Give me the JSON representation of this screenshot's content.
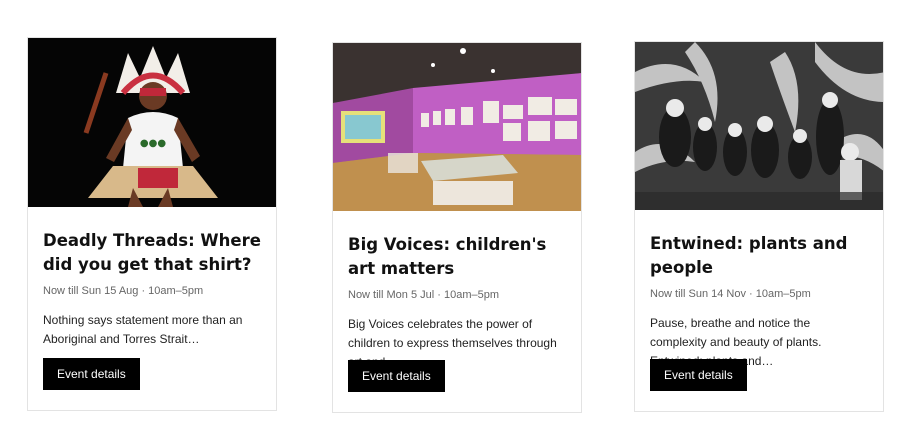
{
  "cards": [
    {
      "title": "Deadly Threads: Where did you get that shirt?",
      "meta": "Now till Sun 15 Aug · 10am–5pm",
      "description": "Nothing says statement more than an Aboriginal and Torres Strait…",
      "button_label": "Event details",
      "image_alt": "Dancer in ceremonial headdress and grass skirt"
    },
    {
      "title": "Big Voices: children's art matters",
      "meta": "Now till Mon 5 Jul · 10am–5pm",
      "description": "Big Voices celebrates the power of children to express themselves through art and…",
      "button_label": "Event details",
      "image_alt": "Gallery room with purple walls and framed children's artworks"
    },
    {
      "title": "Entwined: plants and people",
      "meta": "Now till Sun 14 Nov · 10am–5pm",
      "description": "Pause, breathe and notice the complexity and beauty of plants. Entwined: plants and…",
      "button_label": "Event details",
      "image_alt": "Black and white photograph of people among ferns"
    }
  ],
  "colors": {
    "button_bg": "#000000",
    "button_text": "#ffffff",
    "border": "#e3e3e3",
    "meta": "#666666"
  }
}
